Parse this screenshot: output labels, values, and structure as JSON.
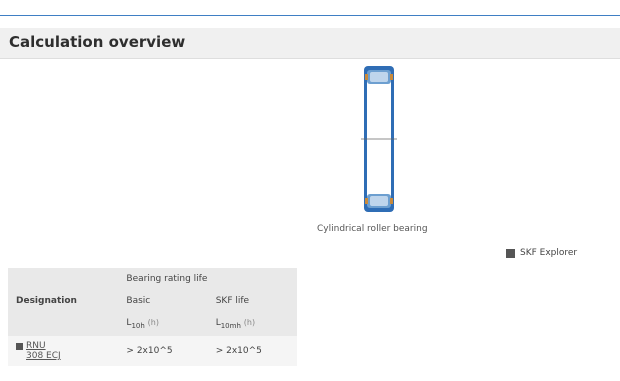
{
  "header": {
    "title": "Calculation overview"
  },
  "diagram": {
    "caption": "Cylindrical roller bearing",
    "icon": "cylindrical-roller-bearing-icon",
    "colors": {
      "outer": "#2f6db5",
      "roller": "#6d9fd0",
      "accent": "#c98a3b"
    }
  },
  "legend": {
    "label": "SKF Explorer",
    "color": "#555555"
  },
  "table": {
    "group_header": "Bearing rating life",
    "col_designation": "Designation",
    "col_basic": "Basic",
    "col_skf": "SKF life",
    "basic_symbol": "L",
    "basic_sub": "10h",
    "basic_unit": "(h)",
    "skf_symbol": "L",
    "skf_sub": "10mh",
    "skf_unit": "(h)",
    "rows": [
      {
        "designation": "RNU 308 ECJ",
        "basic": "> 2x10^5",
        "skf": "> 2x10^5"
      }
    ]
  }
}
